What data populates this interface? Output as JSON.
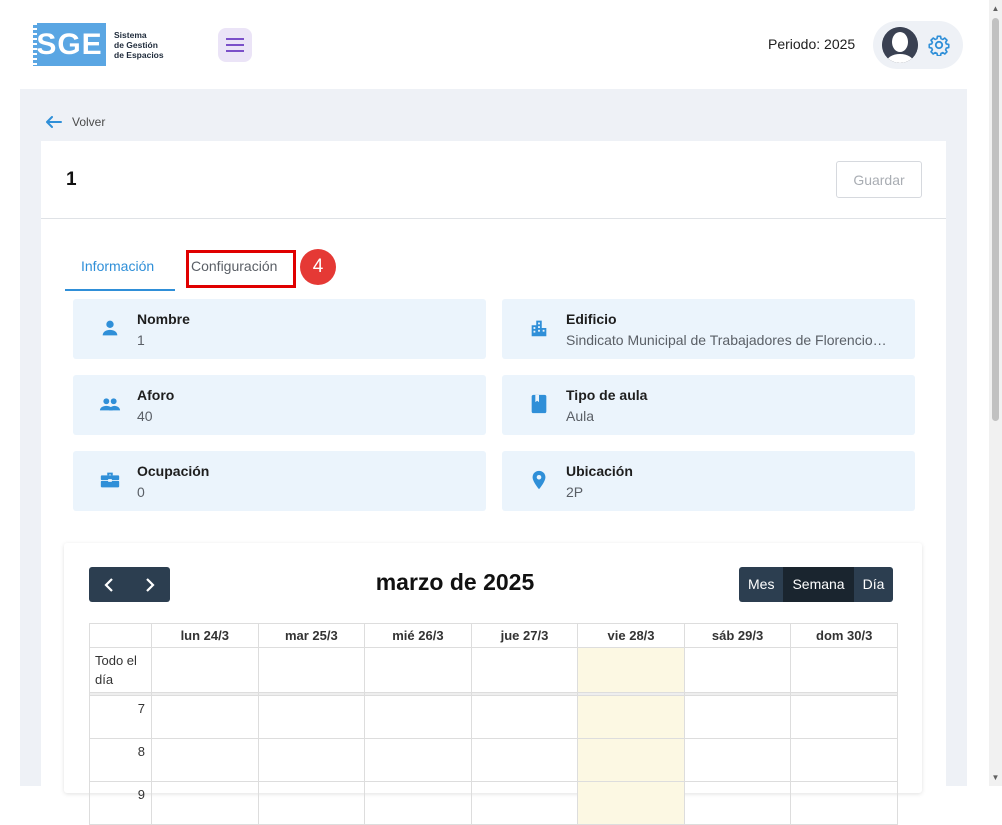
{
  "header": {
    "logo_text": "SGE",
    "logo_subtitle": "Sistema\nde Gestión\nde Espacios",
    "period": "Periodo: 2025"
  },
  "nav": {
    "back_label": "Volver"
  },
  "card": {
    "title": "1",
    "save_label": "Guardar"
  },
  "tabs": [
    {
      "label": "Información",
      "active": true
    },
    {
      "label": "Configuración",
      "active": false
    }
  ],
  "annotation": {
    "badge": "4"
  },
  "info": {
    "nombre": {
      "label": "Nombre",
      "value": "1",
      "icon": "person-icon"
    },
    "edificio": {
      "label": "Edificio",
      "value": "Sindicato Municipal de Trabajadores de Florencio…",
      "icon": "building-icon"
    },
    "aforo": {
      "label": "Aforo",
      "value": "40",
      "icon": "group-icon"
    },
    "tipo": {
      "label": "Tipo de aula",
      "value": "Aula",
      "icon": "book-icon"
    },
    "ocupacion": {
      "label": "Ocupación",
      "value": "0",
      "icon": "briefcase-icon"
    },
    "ubicacion": {
      "label": "Ubicación",
      "value": "2P",
      "icon": "location-pin-icon"
    }
  },
  "calendar": {
    "title": "marzo de 2025",
    "views": [
      "Mes",
      "Semana",
      "Día"
    ],
    "active_view": "Semana",
    "days": [
      "lun 24/3",
      "mar 25/3",
      "mié 26/3",
      "jue 27/3",
      "vie 28/3",
      "sáb 29/3",
      "dom 30/3"
    ],
    "today_index": 4,
    "allday_label": "Todo el día",
    "hours": [
      "7",
      "8",
      "9"
    ]
  },
  "colors": {
    "accent": "#2f8fd8",
    "nav_dark": "#2c3e50",
    "info_bg": "#ebf4fc",
    "today_bg": "#fcf8e3",
    "highlight": "#e00000"
  }
}
